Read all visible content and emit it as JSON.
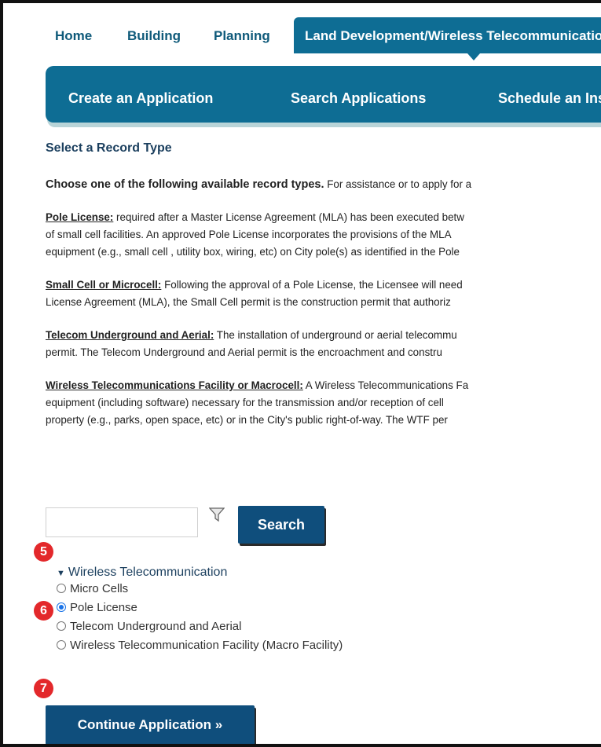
{
  "tabs": {
    "home": "Home",
    "building": "Building",
    "planning": "Planning",
    "active": "Land Development/Wireless Telecommunication"
  },
  "subnav": {
    "create": "Create an Application",
    "search": "Search Applications",
    "schedule": "Schedule an Inspection"
  },
  "content": {
    "title": "Select a Record Type",
    "lead_bold": "Choose one of the following available record types.",
    "lead_rest": " For assistance or to apply for a",
    "pole": {
      "term": "Pole License:",
      "l1": " required after a Master License Agreement (MLA) has been executed betw",
      "l2": "of small cell facilities.  An approved Pole License incorporates the provisions of the MLA",
      "l3": "equipment (e.g., small cell , utility box, wiring, etc) on City pole(s) as identified in the Pole"
    },
    "small": {
      "term": "Small Cell or Microcell:",
      "l1": " Following the approval of a Pole License, the Licensee will need",
      "l2": "License Agreement (MLA), the Small Cell permit is the construction permit that authoriz"
    },
    "telecom": {
      "term": "Telecom Underground and Aerial:",
      "l1": " The installation of underground or aerial telecommu",
      "l2": "permit.  The Telecom Underground and Aerial permit is the encroachment and constru"
    },
    "wireless": {
      "term": "Wireless Telecommunications Facility or Macrocell:",
      "l1": " A Wireless Telecommunications Fa",
      "l2": "equipment (including software) necessary for the transmission and/or reception of cell",
      "l3": "property (e.g., parks, open space, etc) or in the City's public right-of-way.  The WTF per"
    }
  },
  "search": {
    "value": "",
    "placeholder": "",
    "button_label": "Search"
  },
  "markers": [
    "5",
    "6",
    "7"
  ],
  "tree": {
    "group_label": "Wireless Telecommunication",
    "options": [
      {
        "label": "Micro Cells",
        "checked": false
      },
      {
        "label": "Pole License",
        "checked": true
      },
      {
        "label": "Telecom Underground and Aerial",
        "checked": false
      },
      {
        "label": "Wireless Telecommunication Facility (Macro Facility)",
        "checked": false
      }
    ]
  },
  "continue_label": "Continue Application »",
  "icons": {
    "filter": "filter-icon",
    "expand": "triangle-down-icon"
  },
  "colors": {
    "primary": "#0e6d94",
    "button": "#0f4e7c",
    "marker": "#e3282b",
    "radio_selected": "#1a73e8"
  }
}
